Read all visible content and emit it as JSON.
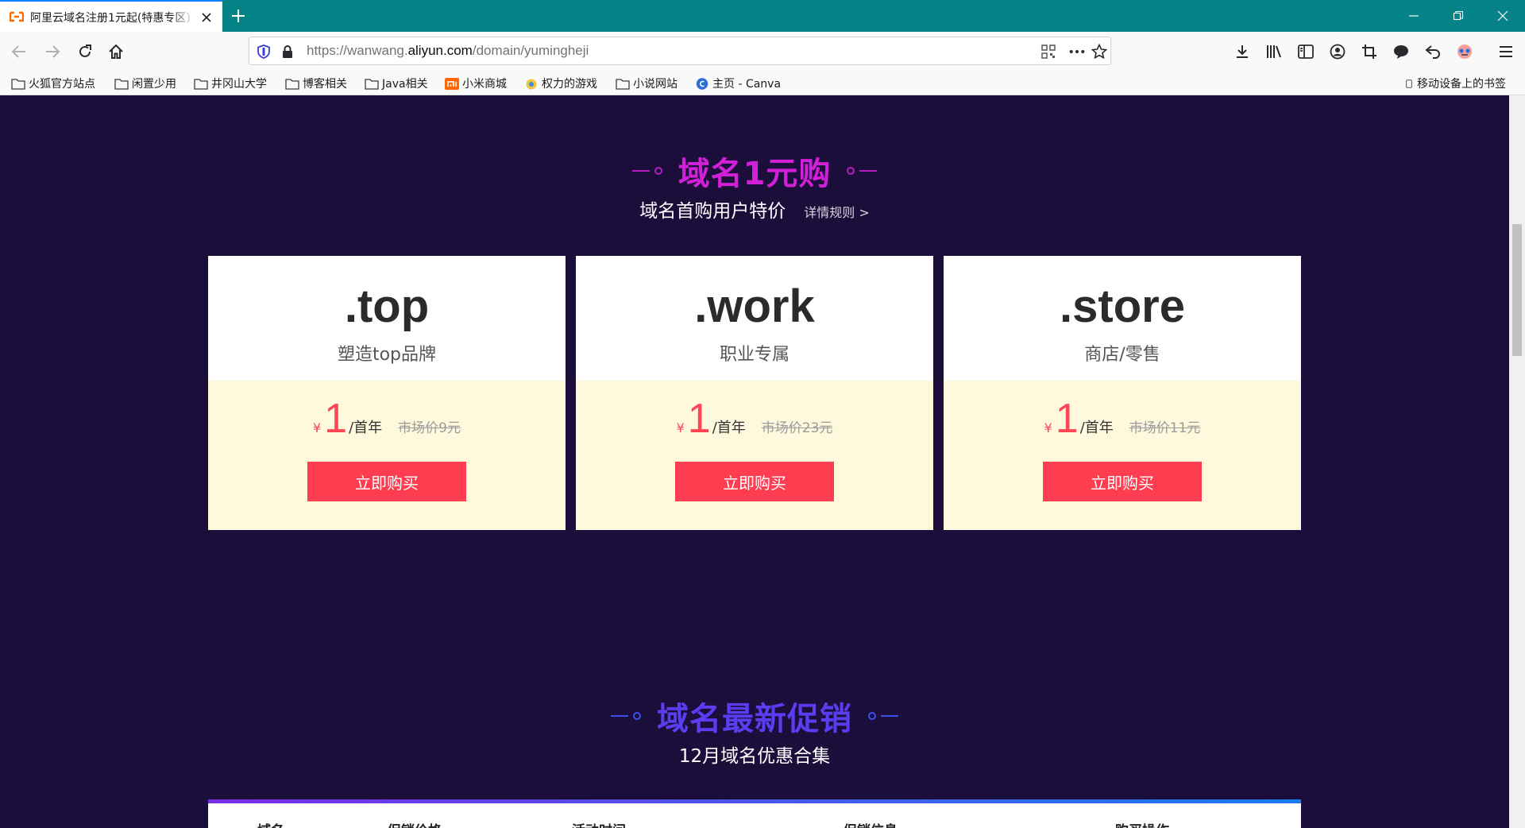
{
  "browser": {
    "tab_title": "阿里云域名注册1元起(特惠专区)",
    "url_prefix": "https://wanwang.",
    "url_host": "aliyun.com",
    "url_path": "/domain/yumingheji"
  },
  "bookmarks": [
    {
      "label": "火狐官方站点",
      "icon": "folder-icon"
    },
    {
      "label": "闲置少用",
      "icon": "folder-icon"
    },
    {
      "label": "井冈山大学",
      "icon": "folder-icon"
    },
    {
      "label": "博客相关",
      "icon": "folder-icon"
    },
    {
      "label": "Java相关",
      "icon": "folder-icon"
    },
    {
      "label": "小米商城",
      "icon": "mi-icon"
    },
    {
      "label": "权力的游戏",
      "icon": "game-icon"
    },
    {
      "label": "小说网站",
      "icon": "folder-icon"
    },
    {
      "label": "主页 - Canva",
      "icon": "canva-icon"
    }
  ],
  "mobile_bookmarks": "移动设备上的书签",
  "promo": {
    "title": "域名1元购",
    "subtitle": "域名首购用户特价",
    "rules_link": "详情规则 >",
    "title_color": "#d21fd8"
  },
  "cards": [
    {
      "tld": ".top",
      "desc": "塑造top品牌",
      "currency": "¥",
      "price": "1",
      "unit": "/首年",
      "original": "市场价9元",
      "button": "立即购买"
    },
    {
      "tld": ".work",
      "desc": "职业专属",
      "currency": "¥",
      "price": "1",
      "unit": "/首年",
      "original": "市场价23元",
      "button": "立即购买"
    },
    {
      "tld": ".store",
      "desc": "商店/零售",
      "currency": "¥",
      "price": "1",
      "unit": "/首年",
      "original": "市场价11元",
      "button": "立即购买"
    }
  ],
  "latest": {
    "title": "域名最新促销",
    "subtitle": "12月域名优惠合集",
    "title_color": "#5a3df0"
  },
  "table_headers": [
    "域名",
    "促销价格",
    "活动时间",
    "促销信息",
    "购买操作"
  ],
  "colors": {
    "page_bg": "#1b0e3a",
    "accent_red": "#ff3d50",
    "tabstrip": "#068387"
  }
}
